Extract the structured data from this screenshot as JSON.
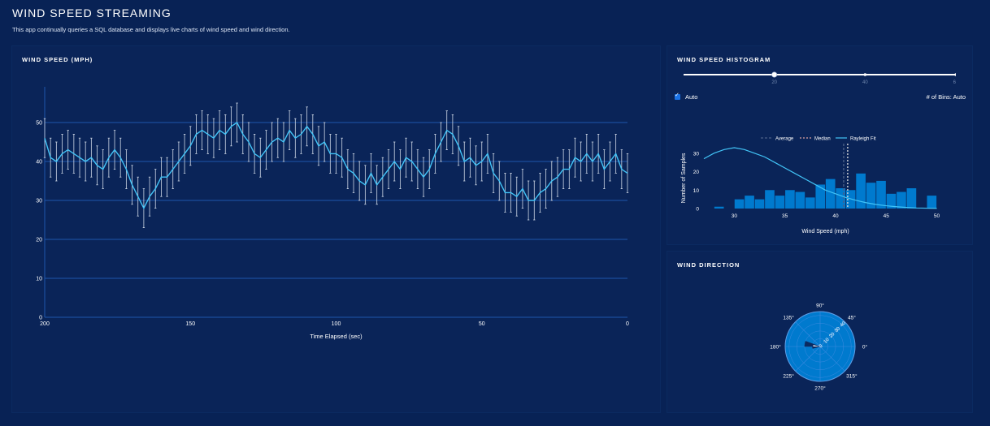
{
  "app": {
    "title": "WIND SPEED STREAMING",
    "description": "This app continually queries a SQL database and displays live charts of wind speed and wind direction."
  },
  "panels": {
    "wind_speed_title": "WIND SPEED (MPH)",
    "histogram_title": "WIND SPEED HISTOGRAM",
    "direction_title": "WIND DIRECTION"
  },
  "colors": {
    "background": "#082255",
    "panel": "#0a2458",
    "line": "#42c4f7",
    "bar": "#007ACE",
    "grid": "#1f56ad"
  },
  "slider": {
    "marks": [
      "20",
      "40",
      "60"
    ],
    "value": 20,
    "min": 0,
    "max": 60
  },
  "auto_checkbox": {
    "label": "Auto",
    "checked": true
  },
  "bins_label": "# of Bins: Auto",
  "chart_data": [
    {
      "type": "line",
      "title": "WIND SPEED (MPH)",
      "xlabel": "Time Elapsed (sec)",
      "ylabel": "",
      "xlim": [
        200,
        0
      ],
      "ylim": [
        0,
        55
      ],
      "xticks": [
        "200",
        "150",
        "100",
        "50",
        "0"
      ],
      "yticks": [
        "0",
        "10",
        "20",
        "30",
        "40",
        "50"
      ],
      "error_bars": true,
      "error_half_width": 5,
      "x": [
        200,
        198,
        196,
        194,
        192,
        190,
        188,
        186,
        184,
        182,
        180,
        178,
        176,
        174,
        172,
        170,
        168,
        166,
        164,
        162,
        160,
        158,
        156,
        154,
        152,
        150,
        148,
        146,
        144,
        142,
        140,
        138,
        136,
        134,
        132,
        130,
        128,
        126,
        124,
        122,
        120,
        118,
        116,
        114,
        112,
        110,
        108,
        106,
        104,
        102,
        100,
        98,
        96,
        94,
        92,
        90,
        88,
        86,
        84,
        82,
        80,
        78,
        76,
        74,
        72,
        70,
        68,
        66,
        64,
        62,
        60,
        58,
        56,
        54,
        52,
        50,
        48,
        46,
        44,
        42,
        40,
        38,
        36,
        34,
        32,
        30,
        28,
        26,
        24,
        22,
        20,
        18,
        16,
        14,
        12,
        10,
        8,
        6,
        4,
        2,
        0
      ],
      "y": [
        46,
        41,
        40,
        42,
        43,
        42,
        41,
        40,
        41,
        39,
        38,
        41,
        43,
        41,
        38,
        34,
        31,
        28,
        31,
        33,
        36,
        36,
        38,
        40,
        42,
        44,
        47,
        48,
        47,
        46,
        48,
        47,
        49,
        50,
        47,
        45,
        42,
        41,
        43,
        45,
        46,
        45,
        48,
        46,
        47,
        49,
        47,
        44,
        45,
        42,
        42,
        41,
        38,
        37,
        35,
        34,
        37,
        34,
        36,
        38,
        40,
        38,
        41,
        40,
        38,
        36,
        38,
        42,
        45,
        48,
        47,
        44,
        40,
        41,
        39,
        40,
        42,
        37,
        35,
        32,
        32,
        31,
        33,
        30,
        30,
        32,
        33,
        35,
        36,
        38,
        38,
        41,
        40,
        42,
        40,
        42,
        38,
        40,
        42,
        38,
        37
      ]
    },
    {
      "type": "bar",
      "xlabel": "Wind Speed (mph)",
      "ylabel": "Number of Samples",
      "xlim": [
        27,
        51
      ],
      "ylim": [
        0,
        33
      ],
      "xticks": [
        "30",
        "35",
        "40",
        "45",
        "50"
      ],
      "yticks": [
        "0",
        "10",
        "20",
        "30"
      ],
      "legend": [
        "Average",
        "Median",
        "Rayleigh Fit"
      ],
      "legend_position": "top",
      "bin_centers": [
        28.5,
        30.5,
        31.5,
        32.5,
        33.5,
        34.5,
        35.5,
        36.5,
        37.5,
        38.5,
        39.5,
        40.5,
        41.5,
        42.5,
        43.5,
        44.5,
        45.5,
        46.5,
        47.5,
        48.5,
        49.5
      ],
      "counts": [
        1,
        5,
        7,
        5,
        10,
        7,
        10,
        9,
        6,
        13,
        16,
        11,
        10,
        19,
        14,
        15,
        8,
        9,
        11,
        0,
        7
      ],
      "average": 40.8,
      "median": 41.2,
      "rayleigh_fit": {
        "x": [
          27,
          28,
          29,
          30,
          31,
          32,
          33,
          34,
          35,
          36,
          37,
          38,
          39,
          40,
          41,
          42,
          43,
          44,
          45,
          46,
          47,
          48,
          49,
          50
        ],
        "y": [
          27,
          30,
          32,
          33,
          32,
          30,
          28,
          25,
          22,
          19,
          16,
          13,
          10,
          8,
          6,
          4.5,
          3.2,
          2.2,
          1.5,
          1,
          0.6,
          0.3,
          0.2,
          0.1
        ]
      }
    },
    {
      "type": "polar_bar",
      "title": "WIND DIRECTION",
      "angular_ticks": [
        "90°",
        "45°",
        "0°",
        "315°",
        "270°",
        "225°",
        "180°",
        "135°"
      ],
      "radial_ticks": [
        "0",
        "10",
        "20",
        "30",
        "40"
      ],
      "radial_range": [
        0,
        45
      ],
      "bars": [
        {
          "direction_deg": 170,
          "width_deg": 20,
          "value": 20
        },
        {
          "direction_deg": 185,
          "width_deg": 20,
          "value": 10
        }
      ]
    }
  ]
}
